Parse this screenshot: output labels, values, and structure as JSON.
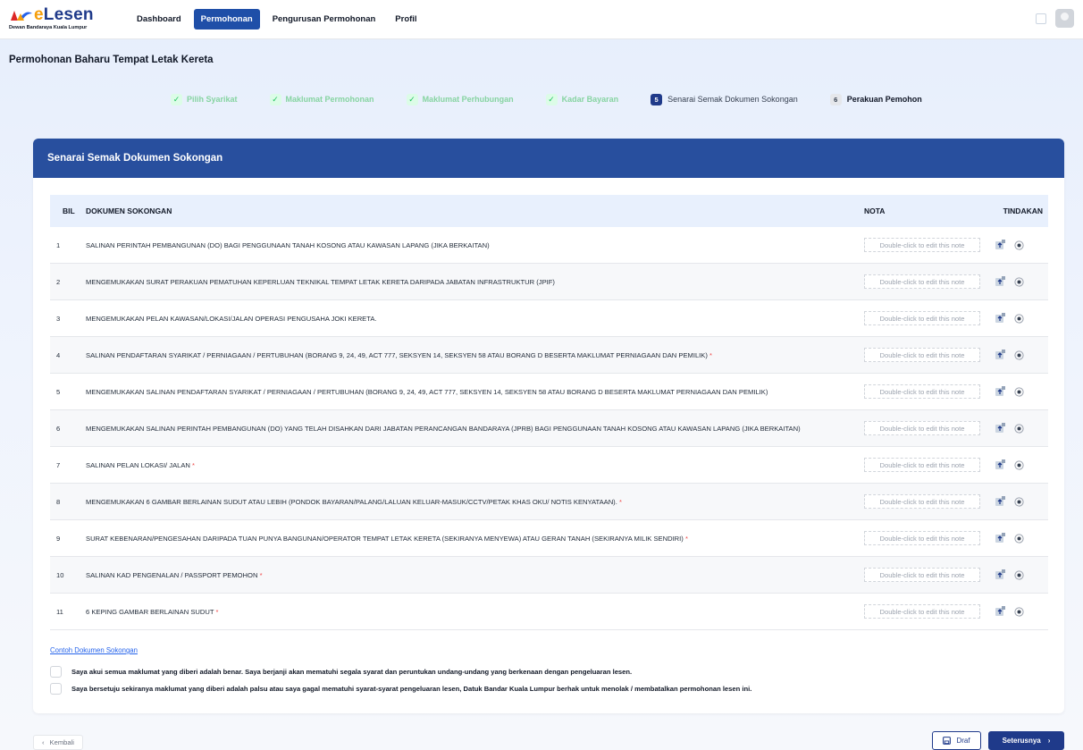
{
  "brand": {
    "name_e": "e",
    "name_rest": "Lesen",
    "subtitle": "Dewan Bandaraya Kuala Lumpur"
  },
  "nav": {
    "items": [
      {
        "label": "Dashboard",
        "active": false
      },
      {
        "label": "Permohonan",
        "active": true
      },
      {
        "label": "Pengurusan Permohonan",
        "active": false
      },
      {
        "label": "Profil",
        "active": false
      }
    ]
  },
  "page": {
    "title": "Permohonan Baharu Tempat Letak Kereta"
  },
  "stepper": {
    "steps": [
      {
        "label": "Pilih Syarikat",
        "state": "done",
        "mark": "✓"
      },
      {
        "label": "Maklumat Permohonan",
        "state": "done",
        "mark": "✓"
      },
      {
        "label": "Maklumat Perhubungan",
        "state": "done",
        "mark": "✓"
      },
      {
        "label": "Kadar Bayaran",
        "state": "done",
        "mark": "✓"
      },
      {
        "label": "Senarai Semak Dokumen Sokongan",
        "state": "current",
        "mark": "5"
      },
      {
        "label": "Perakuan Pemohon",
        "state": "pending",
        "mark": "6"
      }
    ]
  },
  "card": {
    "title": "Senarai Semak Dokumen Sokongan"
  },
  "table": {
    "headers": {
      "bil": "BIL",
      "doc": "DOKUMEN SOKONGAN",
      "nota": "NOTA",
      "tindakan": "TINDAKAN"
    },
    "note_placeholder": "Double-click to edit this note",
    "rows": [
      {
        "bil": "1",
        "doc": "SALINAN PERINTAH PEMBANGUNAN (DO) BAGI PENGGUNAAN TANAH KOSONG ATAU KAWASAN LAPANG (JIKA BERKAITAN)",
        "required": ""
      },
      {
        "bil": "2",
        "doc": "MENGEMUKAKAN SURAT PERAKUAN PEMATUHAN KEPERLUAN TEKNIKAL TEMPAT LETAK KERETA DARIPADA JABATAN INFRASTRUKTUR (JPIF)",
        "required": ""
      },
      {
        "bil": "3",
        "doc": "MENGEMUKAKAN PELAN KAWASAN/LOKASI/JALAN OPERASI PENGUSAHA JOKI KERETA.",
        "required": ""
      },
      {
        "bil": "4",
        "doc": "SALINAN PENDAFTARAN SYARIKAT / PERNIAGAAN / PERTUBUHAN (BORANG 9, 24, 49, ACT 777, SEKSYEN 14, SEKSYEN 58 ATAU BORANG D BESERTA MAKLUMAT PERNIAGAAN DAN PEMILIK)",
        "required": "*"
      },
      {
        "bil": "5",
        "doc": "MENGEMUKAKAN SALINAN PENDAFTARAN SYARIKAT / PERNIAGAAN / PERTUBUHAN (BORANG 9, 24, 49, ACT 777, SEKSYEN 14, SEKSYEN 58 ATAU BORANG D BESERTA MAKLUMAT PERNIAGAAN DAN PEMILIK)",
        "required": ""
      },
      {
        "bil": "6",
        "doc": "MENGEMUKAKAN SALINAN PERINTAH PEMBANGUNAN (DO) YANG TELAH DISAHKAN DARI JABATAN PERANCANGAN BANDARAYA (JPRB) BAGI PENGGUNAAN TANAH KOSONG ATAU KAWASAN LAPANG (JIKA BERKAITAN)",
        "required": ""
      },
      {
        "bil": "7",
        "doc": "SALINAN PELAN LOKASI/ JALAN",
        "required": "*"
      },
      {
        "bil": "8",
        "doc": "MENGEMUKAKAN 6 GAMBAR BERLAINAN SUDUT ATAU LEBIH (PONDOK BAYARAN/PALANG/LALUAN KELUAR-MASUK/CCTV/PETAK KHAS OKU/ NOTIS KENYATAAN).",
        "required": "*"
      },
      {
        "bil": "9",
        "doc": "SURAT KEBENARAN/PENGESAHAN DARIPADA TUAN PUNYA BANGUNAN/OPERATOR TEMPAT LETAK KERETA (SEKIRANYA MENYEWA) ATAU GERAN TANAH (SEKIRANYA MILIK SENDIRI)",
        "required": "*"
      },
      {
        "bil": "10",
        "doc": "SALINAN KAD PENGENALAN / PASSPORT PEMOHON",
        "required": "*"
      },
      {
        "bil": "11",
        "doc": "6 KEPING GAMBAR BERLAINAN SUDUT",
        "required": "*"
      }
    ]
  },
  "sample_link": "Contoh Dokumen Sokongan",
  "declarations": [
    "Saya akui semua maklumat yang diberi adalah benar. Saya berjanji akan mematuhi segala syarat dan peruntukan undang-undang yang berkenaan dengan pengeluaran lesen.",
    "Saya bersetuju sekiranya maklumat yang diberi adalah palsu atau saya gagal mematuhi syarat-syarat pengeluaran lesen, Datuk Bandar Kuala Lumpur berhak untuk menolak / membatalkan permohonan lesen ini."
  ],
  "buttons": {
    "back": "Kembali",
    "draft": "Draf",
    "next": "Seterusnya"
  },
  "colors": {
    "primary": "#1f3a8a",
    "header": "#284f9e",
    "done": "#86d4a1",
    "required": "#ef4444",
    "link": "#2563eb"
  }
}
